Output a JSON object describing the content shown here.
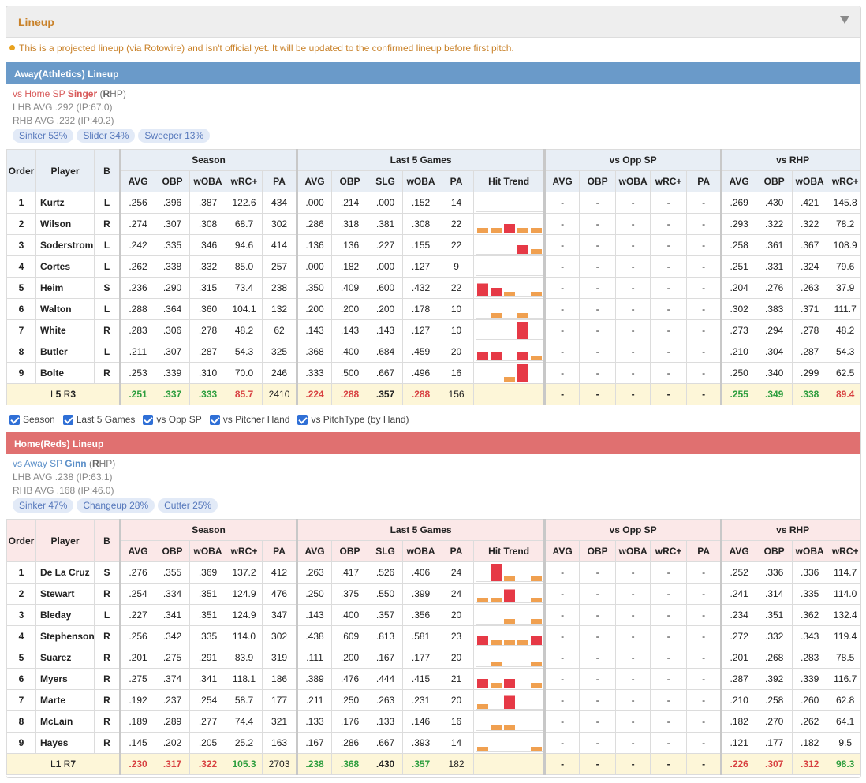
{
  "title": "Lineup",
  "note": "This is a projected lineup (via Rotowire) and isn't official yet. It will be updated to the confirmed lineup before first pitch.",
  "colors": {
    "accent": "#c9822a",
    "away": "#6a9ac9",
    "home": "#e07070",
    "trend_red": "#e63946",
    "trend_orange": "#f0a050"
  },
  "headers": {
    "groups": [
      "Season",
      "Last 5 Games",
      "vs Opp SP",
      "vs RHP"
    ],
    "order": "Order",
    "player": "Player",
    "b": "B",
    "season": [
      "AVG",
      "OBP",
      "wOBA",
      "wRC+",
      "PA"
    ],
    "last5": [
      "AVG",
      "OBP",
      "SLG",
      "wOBA",
      "PA",
      "Hit Trend"
    ],
    "opp": [
      "AVG",
      "OBP",
      "wOBA",
      "wRC+",
      "PA"
    ],
    "hand": [
      "AVG",
      "OBP",
      "wOBA",
      "wRC+"
    ]
  },
  "checkboxes": [
    "Season",
    "Last 5 Games",
    "vs Opp SP",
    "vs Pitcher Hand",
    "vs PitchType (by Hand)"
  ],
  "away": {
    "band": "Away(Athletics) Lineup",
    "sp_prefix": "vs Home SP",
    "sp_name": "Singer",
    "hand_open": "(",
    "hand_bold": "R",
    "hand_rest": "HP)",
    "lhb": "LHB AVG .292 (IP:67.0)",
    "rhb": "RHB AVG .232 (IP:40.2)",
    "pitches": [
      "Sinker 53%",
      "Slider 34%",
      "Sweeper 13%"
    ],
    "rows": [
      {
        "o": "1",
        "n": "Kurtz",
        "b": "L",
        "s": [
          ".256",
          ".396",
          ".387",
          "122.6",
          "434"
        ],
        "l": [
          ".000",
          ".214",
          ".000",
          ".152",
          "14"
        ],
        "t": [
          0,
          0,
          0,
          0,
          0
        ],
        "h": [
          ".269",
          ".430",
          ".421",
          "145.8"
        ]
      },
      {
        "o": "2",
        "n": "Wilson",
        "b": "R",
        "s": [
          ".274",
          ".307",
          ".308",
          "68.7",
          "302"
        ],
        "l": [
          ".286",
          ".318",
          ".381",
          ".308",
          "22"
        ],
        "t": [
          1,
          1,
          2,
          1,
          1
        ],
        "h": [
          ".293",
          ".322",
          ".322",
          "78.2"
        ]
      },
      {
        "o": "3",
        "n": "Soderstrom",
        "b": "L",
        "s": [
          ".242",
          ".335",
          ".346",
          "94.6",
          "414"
        ],
        "l": [
          ".136",
          ".136",
          ".227",
          ".155",
          "22"
        ],
        "t": [
          0,
          0,
          0,
          2,
          1
        ],
        "h": [
          ".258",
          ".361",
          ".367",
          "108.9"
        ]
      },
      {
        "o": "4",
        "n": "Cortes",
        "b": "L",
        "s": [
          ".262",
          ".338",
          ".332",
          "85.0",
          "257"
        ],
        "l": [
          ".000",
          ".182",
          ".000",
          ".127",
          "9"
        ],
        "t": [
          0,
          0,
          0,
          0,
          0
        ],
        "h": [
          ".251",
          ".331",
          ".324",
          "79.6"
        ]
      },
      {
        "o": "5",
        "n": "Heim",
        "b": "S",
        "s": [
          ".236",
          ".290",
          ".315",
          "73.4",
          "238"
        ],
        "l": [
          ".350",
          ".409",
          ".600",
          ".432",
          "22"
        ],
        "t": [
          3,
          2,
          1,
          0,
          1
        ],
        "h": [
          ".204",
          ".276",
          ".263",
          "37.9"
        ]
      },
      {
        "o": "6",
        "n": "Walton",
        "b": "L",
        "s": [
          ".288",
          ".364",
          ".360",
          "104.1",
          "132"
        ],
        "l": [
          ".200",
          ".200",
          ".200",
          ".178",
          "10"
        ],
        "t": [
          0,
          1,
          0,
          1,
          0
        ],
        "h": [
          ".302",
          ".383",
          ".371",
          "111.7"
        ]
      },
      {
        "o": "7",
        "n": "White",
        "b": "R",
        "s": [
          ".283",
          ".306",
          ".278",
          "48.2",
          "62"
        ],
        "l": [
          ".143",
          ".143",
          ".143",
          ".127",
          "10"
        ],
        "t": [
          0,
          0,
          0,
          4,
          0
        ],
        "h": [
          ".273",
          ".294",
          ".278",
          "48.2"
        ]
      },
      {
        "o": "8",
        "n": "Butler",
        "b": "L",
        "s": [
          ".211",
          ".307",
          ".287",
          "54.3",
          "325"
        ],
        "l": [
          ".368",
          ".400",
          ".684",
          ".459",
          "20"
        ],
        "t": [
          2,
          2,
          0,
          2,
          1
        ],
        "h": [
          ".210",
          ".304",
          ".287",
          "54.3"
        ]
      },
      {
        "o": "9",
        "n": "Bolte",
        "b": "R",
        "s": [
          ".253",
          ".339",
          ".310",
          "70.0",
          "246"
        ],
        "l": [
          ".333",
          ".500",
          ".667",
          ".496",
          "16"
        ],
        "t": [
          0,
          0,
          1,
          4,
          0
        ],
        "h": [
          ".250",
          ".340",
          ".299",
          "62.5"
        ]
      }
    ],
    "total": {
      "lab1": "L",
      "lab1b": "5",
      "lab2": "R",
      "lab2b": "3",
      "s": [
        ".251",
        ".337",
        ".333",
        "85.7",
        "2410"
      ],
      "sc": [
        "gr",
        "gr",
        "gr",
        "rd",
        ""
      ],
      "l": [
        ".224",
        ".288",
        ".357",
        ".288",
        "156"
      ],
      "lc": [
        "rd",
        "rd",
        "bk",
        "rd",
        ""
      ],
      "o": [
        "-",
        "-",
        "-",
        "-",
        "-"
      ],
      "h": [
        ".255",
        ".349",
        ".338",
        "89.4"
      ],
      "hc": [
        "gr",
        "gr",
        "gr",
        "rd"
      ]
    }
  },
  "home": {
    "band": "Home(Reds) Lineup",
    "sp_prefix": "vs Away SP",
    "sp_name": "Ginn",
    "hand_open": "(",
    "hand_bold": "R",
    "hand_rest": "HP)",
    "lhb": "LHB AVG .238 (IP:63.1)",
    "rhb": "RHB AVG .168 (IP:46.0)",
    "pitches": [
      "Sinker 47%",
      "Changeup 28%",
      "Cutter 25%"
    ],
    "rows": [
      {
        "o": "1",
        "n": "De La Cruz",
        "b": "S",
        "s": [
          ".276",
          ".355",
          ".369",
          "137.2",
          "412"
        ],
        "l": [
          ".263",
          ".417",
          ".526",
          ".406",
          "24"
        ],
        "t": [
          0,
          4,
          1,
          0,
          1
        ],
        "h": [
          ".252",
          ".336",
          ".336",
          "114.7"
        ]
      },
      {
        "o": "2",
        "n": "Stewart",
        "b": "R",
        "s": [
          ".254",
          ".334",
          ".351",
          "124.9",
          "476"
        ],
        "l": [
          ".250",
          ".375",
          ".550",
          ".399",
          "24"
        ],
        "t": [
          1,
          1,
          3,
          0,
          1
        ],
        "h": [
          ".241",
          ".314",
          ".335",
          "114.0"
        ]
      },
      {
        "o": "3",
        "n": "Bleday",
        "b": "L",
        "s": [
          ".227",
          ".341",
          ".351",
          "124.9",
          "347"
        ],
        "l": [
          ".143",
          ".400",
          ".357",
          ".356",
          "20"
        ],
        "t": [
          0,
          0,
          1,
          0,
          1
        ],
        "h": [
          ".234",
          ".351",
          ".362",
          "132.4"
        ]
      },
      {
        "o": "4",
        "n": "Stephenson",
        "b": "R",
        "s": [
          ".256",
          ".342",
          ".335",
          "114.0",
          "302"
        ],
        "l": [
          ".438",
          ".609",
          ".813",
          ".581",
          "23"
        ],
        "t": [
          2,
          1,
          1,
          1,
          2
        ],
        "h": [
          ".272",
          ".332",
          ".343",
          "119.4"
        ]
      },
      {
        "o": "5",
        "n": "Suarez",
        "b": "R",
        "s": [
          ".201",
          ".275",
          ".291",
          "83.9",
          "319"
        ],
        "l": [
          ".111",
          ".200",
          ".167",
          ".177",
          "20"
        ],
        "t": [
          0,
          1,
          0,
          0,
          1
        ],
        "h": [
          ".201",
          ".268",
          ".283",
          "78.5"
        ]
      },
      {
        "o": "6",
        "n": "Myers",
        "b": "R",
        "s": [
          ".275",
          ".374",
          ".341",
          "118.1",
          "186"
        ],
        "l": [
          ".389",
          ".476",
          ".444",
          ".415",
          "21"
        ],
        "t": [
          2,
          1,
          2,
          0,
          1
        ],
        "h": [
          ".287",
          ".392",
          ".339",
          "116.7"
        ]
      },
      {
        "o": "7",
        "n": "Marte",
        "b": "R",
        "s": [
          ".192",
          ".237",
          ".254",
          "58.7",
          "177"
        ],
        "l": [
          ".211",
          ".250",
          ".263",
          ".231",
          "20"
        ],
        "t": [
          1,
          0,
          3,
          0,
          0
        ],
        "h": [
          ".210",
          ".258",
          ".260",
          "62.8"
        ]
      },
      {
        "o": "8",
        "n": "McLain",
        "b": "R",
        "s": [
          ".189",
          ".289",
          ".277",
          "74.4",
          "321"
        ],
        "l": [
          ".133",
          ".176",
          ".133",
          ".146",
          "16"
        ],
        "t": [
          0,
          1,
          1,
          0,
          0
        ],
        "h": [
          ".182",
          ".270",
          ".262",
          "64.1"
        ]
      },
      {
        "o": "9",
        "n": "Hayes",
        "b": "R",
        "s": [
          ".145",
          ".202",
          ".205",
          "25.2",
          "163"
        ],
        "l": [
          ".167",
          ".286",
          ".667",
          ".393",
          "14"
        ],
        "t": [
          1,
          0,
          0,
          0,
          1
        ],
        "h": [
          ".121",
          ".177",
          ".182",
          "9.5"
        ]
      }
    ],
    "total": {
      "lab1": "L",
      "lab1b": "1",
      "lab2": "R",
      "lab2b": "7",
      "s": [
        ".230",
        ".317",
        ".322",
        "105.3",
        "2703"
      ],
      "sc": [
        "rd",
        "rd",
        "rd",
        "gr",
        ""
      ],
      "l": [
        ".238",
        ".368",
        ".430",
        ".357",
        "182"
      ],
      "lc": [
        "gr",
        "gr",
        "bk",
        "gr",
        ""
      ],
      "o": [
        "-",
        "-",
        "-",
        "-",
        "-"
      ],
      "h": [
        ".226",
        ".307",
        ".312",
        "98.3"
      ],
      "hc": [
        "rd",
        "rd",
        "rd",
        "gr"
      ]
    }
  }
}
